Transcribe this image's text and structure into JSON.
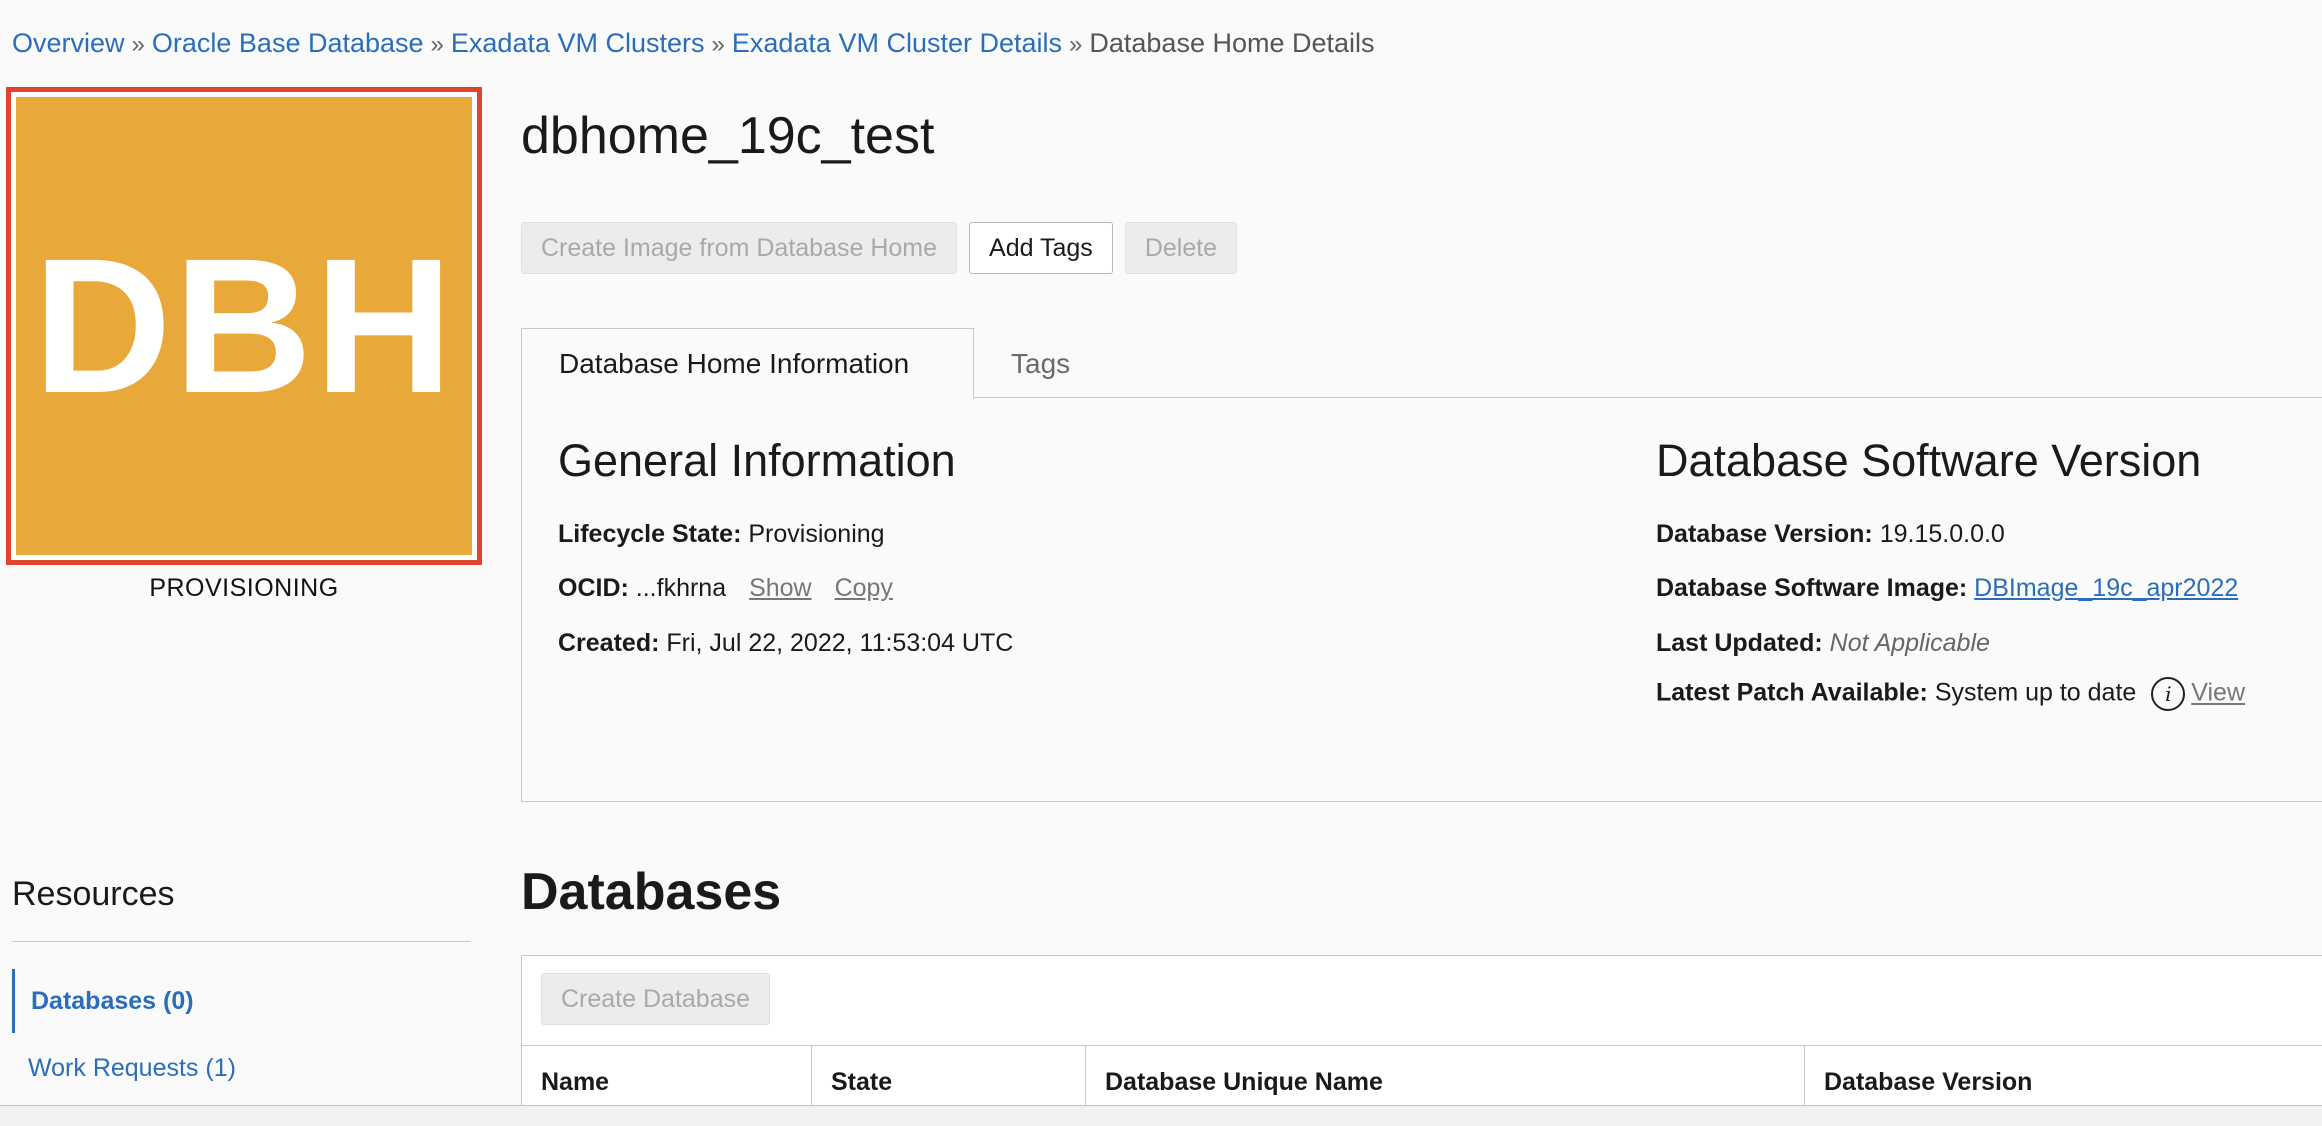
{
  "breadcrumb": {
    "items": [
      "Overview",
      "Oracle Base Database",
      "Exadata VM Clusters",
      "Exadata VM Cluster Details"
    ],
    "current": "Database Home Details",
    "separator": "»"
  },
  "badge": {
    "text": "DBH",
    "status": "PROVISIONING",
    "color": "#e9a83a",
    "highlight_color": "#e0442d"
  },
  "page_title": "dbhome_19c_test",
  "actions": {
    "create_image": "Create Image from Database Home",
    "add_tags": "Add Tags",
    "delete": "Delete"
  },
  "tabs": [
    "Database Home Information",
    "Tags"
  ],
  "general": {
    "title": "General Information",
    "lifecycle_label": "Lifecycle State:",
    "lifecycle_value": "Provisioning",
    "ocid_label": "OCID:",
    "ocid_value": "...fkhrna",
    "ocid_show": "Show",
    "ocid_copy": "Copy",
    "created_label": "Created:",
    "created_value": "Fri, Jul 22, 2022, 11:53:04 UTC"
  },
  "software": {
    "title": "Database Software Version",
    "version_label": "Database Version:",
    "version_value": "19.15.0.0.0",
    "image_label": "Database Software Image:",
    "image_value": "DBImage_19c_apr2022",
    "updated_label": "Last Updated:",
    "updated_value": "Not Applicable",
    "patch_label": "Latest Patch Available:",
    "patch_value": "System up to date",
    "patch_info_icon": "i",
    "patch_view": "View"
  },
  "resources": {
    "title": "Resources",
    "items": [
      "Databases (0)",
      "Work Requests (1)"
    ]
  },
  "databases": {
    "title": "Databases",
    "create_button": "Create Database",
    "columns": [
      "Name",
      "State",
      "Database Unique Name",
      "Database Version"
    ]
  }
}
